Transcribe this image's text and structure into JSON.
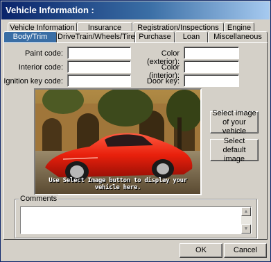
{
  "window": {
    "title": "Vehicle Information :"
  },
  "tabs_back": [
    "Vehicle Information",
    "Insurance",
    "Registration/Inspections",
    "Engine"
  ],
  "tabs_front": [
    "Body/Trim",
    "DriveTrain/Wheels/Tires",
    "Purchase",
    "Loan",
    "Miscellaneous"
  ],
  "active_tab": "Body/Trim",
  "fields": {
    "paint_code": {
      "label": "Paint code:",
      "value": ""
    },
    "interior_code": {
      "label": "Interior code:",
      "value": ""
    },
    "ignition_key_code": {
      "label": "Ignition key code:",
      "value": ""
    },
    "color_exterior": {
      "label": "Color (exterior):",
      "value": ""
    },
    "color_interior": {
      "label": "Color (interior):",
      "value": ""
    },
    "door_key": {
      "label": "Door key:",
      "value": ""
    }
  },
  "image": {
    "caption": "Use Select Image button to display your vehicle here."
  },
  "buttons": {
    "select_image": "Select image of your vehicle",
    "select_default": "Select default image",
    "ok": "OK",
    "cancel": "Cancel"
  },
  "comments": {
    "label": "Comments",
    "value": ""
  },
  "icons": {
    "scroll_up": "scroll-up-arrow",
    "scroll_down": "scroll-down-arrow"
  }
}
